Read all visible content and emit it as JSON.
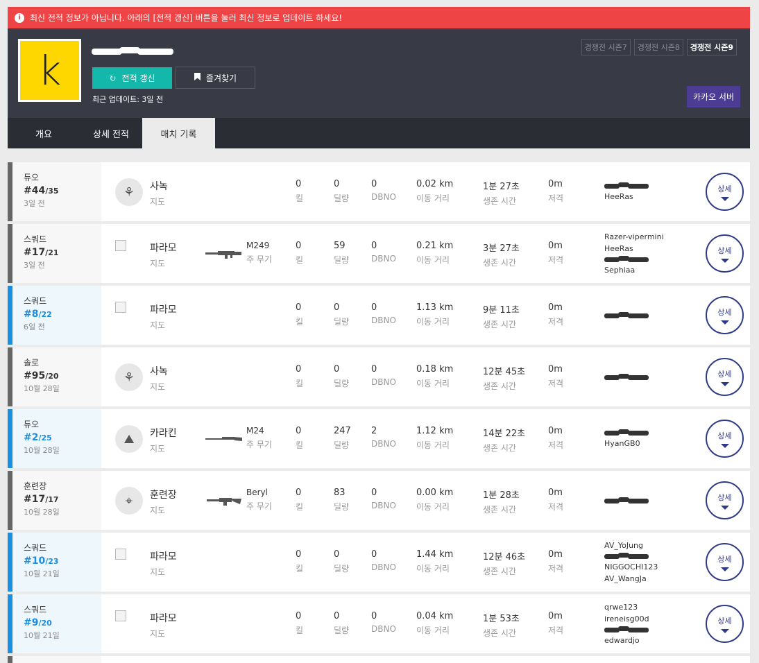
{
  "alert": {
    "icon": "info-icon",
    "text": "최신 전적 정보가 아닙니다. 아래의 [전적 갱신] 버튼을 눌러 최신 정보로 업데이트 하세요!"
  },
  "profile": {
    "avatar_letter": "k",
    "avatar_color": "#ffd700",
    "refresh_label": "전적 갱신",
    "favorite_label": "즐겨찾기",
    "updated": "최근 업데이트: 3일 전"
  },
  "seasons": [
    "경쟁전 시즌7",
    "경쟁전 시즌8",
    "경쟁전 시즌9"
  ],
  "active_season": "경쟁전 시즌9",
  "server_label": "카카오 서버",
  "tabs": [
    "개요",
    "상세 전적",
    "매치 기록"
  ],
  "active_tab": "매치 기록",
  "labels": {
    "map": "지도",
    "weapon": "주 무기",
    "kill": "킬",
    "damage": "딜량",
    "dbno": "DBNO",
    "distance": "이동 거리",
    "survival": "생존 시간",
    "snipe": "저격",
    "detail": "상세"
  },
  "matches": [
    {
      "mode": "듀오",
      "rank": "#44",
      "total": "/35",
      "date": "3일 전",
      "highlight": false,
      "map": "사녹",
      "map_icon": "palm-tree-icon",
      "weapon": "",
      "kills": "0",
      "damage": "0",
      "dbno": "0",
      "distance": "0.02 km",
      "survival": "1분 27초",
      "snipe": "0m",
      "team": [
        "",
        "HeeRas"
      ]
    },
    {
      "mode": "스쿼드",
      "rank": "#17",
      "total": "/21",
      "date": "3일 전",
      "highlight": false,
      "map": "파라모",
      "map_icon": "broken-image-icon",
      "weapon": "M249",
      "kills": "0",
      "damage": "59",
      "dbno": "0",
      "distance": "0.21 km",
      "survival": "3분 27초",
      "snipe": "0m",
      "team": [
        "Razer-vipermini",
        "HeeRas",
        "",
        "Sephiaa"
      ]
    },
    {
      "mode": "스쿼드",
      "rank": "#8",
      "total": "/22",
      "date": "6일 전",
      "highlight": true,
      "map": "파라모",
      "map_icon": "broken-image-icon",
      "weapon": "",
      "kills": "0",
      "damage": "0",
      "dbno": "0",
      "distance": "1.13 km",
      "survival": "9분 11초",
      "snipe": "0m",
      "team": [
        ""
      ]
    },
    {
      "mode": "솔로",
      "rank": "#95",
      "total": "/20",
      "date": "10월 28일",
      "highlight": false,
      "map": "사녹",
      "map_icon": "palm-tree-icon",
      "weapon": "",
      "kills": "0",
      "damage": "0",
      "dbno": "0",
      "distance": "0.18 km",
      "survival": "12분 45초",
      "snipe": "0m",
      "team": [
        ""
      ]
    },
    {
      "mode": "듀오",
      "rank": "#2",
      "total": "/25",
      "date": "10월 28일",
      "highlight": true,
      "map": "카라킨",
      "map_icon": "island-icon",
      "weapon": "M24",
      "kills": "0",
      "damage": "247",
      "dbno": "2",
      "distance": "1.12 km",
      "survival": "14분 22초",
      "snipe": "0m",
      "team": [
        "",
        "HyanGB0"
      ]
    },
    {
      "mode": "훈련장",
      "rank": "#17",
      "total": "/17",
      "date": "10월 28일",
      "highlight": false,
      "map": "훈련장",
      "map_icon": "crosshair-icon",
      "weapon": "Beryl",
      "kills": "0",
      "damage": "83",
      "dbno": "0",
      "distance": "0.00 km",
      "survival": "1분 28초",
      "snipe": "0m",
      "team": [
        ""
      ]
    },
    {
      "mode": "스쿼드",
      "rank": "#10",
      "total": "/23",
      "date": "10월 21일",
      "highlight": true,
      "map": "파라모",
      "map_icon": "broken-image-icon",
      "weapon": "",
      "kills": "0",
      "damage": "0",
      "dbno": "0",
      "distance": "1.44 km",
      "survival": "12분 46초",
      "snipe": "0m",
      "team": [
        "AV_YoJung",
        "",
        "NIGGOCHI123",
        "AV_WangJa"
      ]
    },
    {
      "mode": "스쿼드",
      "rank": "#9",
      "total": "/20",
      "date": "10월 21일",
      "highlight": true,
      "map": "파라모",
      "map_icon": "broken-image-icon",
      "weapon": "",
      "kills": "0",
      "damage": "0",
      "dbno": "0",
      "distance": "0.04 km",
      "survival": "1분 53초",
      "snipe": "0m",
      "team": [
        "qrwe123",
        "ireneisg00d",
        "",
        "edwardjo"
      ]
    }
  ]
}
